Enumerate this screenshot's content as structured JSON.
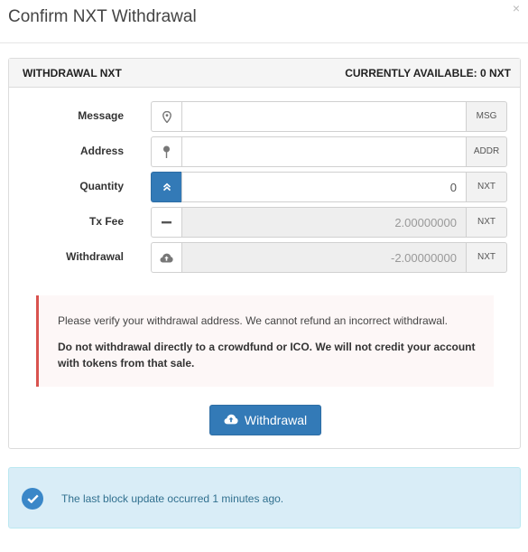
{
  "modal": {
    "title": "Confirm NXT Withdrawal",
    "close": "×"
  },
  "panel": {
    "heading_left": "WITHDRAWAL NXT",
    "heading_right": "CURRENTLY AVAILABLE: 0 NXT"
  },
  "form": {
    "message": {
      "label": "Message",
      "icon": "map-marker-icon",
      "value": "",
      "addon": "MSG"
    },
    "address": {
      "label": "Address",
      "icon": "pin-icon",
      "value": "",
      "addon": "ADDR"
    },
    "quantity": {
      "label": "Quantity",
      "icon": "double-chevron-up-icon",
      "value": "0",
      "addon": "NXT"
    },
    "tx_fee": {
      "label": "Tx Fee",
      "icon": "minus-icon",
      "value": "2.00000000",
      "addon": "NXT"
    },
    "withdrawal": {
      "label": "Withdrawal",
      "icon": "cloud-upload-icon",
      "value": "-2.00000000",
      "addon": "NXT"
    }
  },
  "warning": {
    "line1": "Please verify your withdrawal address. We cannot refund an incorrect withdrawal.",
    "line2": "Do not withdrawal directly to a crowdfund or ICO. We will not credit your account with tokens from that sale."
  },
  "button": {
    "label": "Withdrawal",
    "icon": "cloud-upload-icon"
  },
  "info": {
    "icon": "check-circle-icon",
    "message": "The last block update occurred 1 minutes ago."
  },
  "colors": {
    "primary": "#337ab7",
    "danger": "#d9534f",
    "info_bg": "#d9edf7",
    "info_text": "#31708f"
  }
}
